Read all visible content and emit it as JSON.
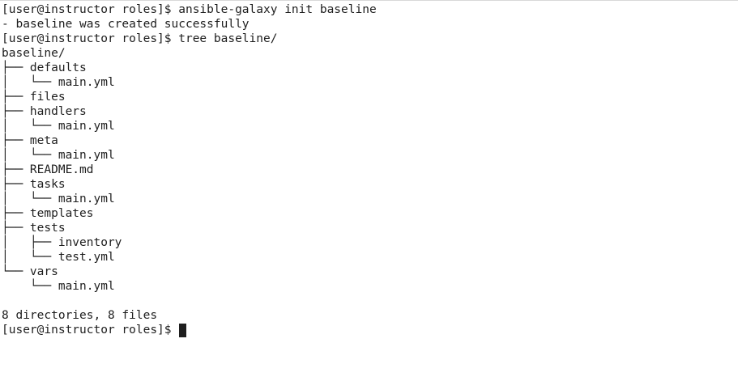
{
  "terminal": {
    "lines": [
      "[user@instructor roles]$ ansible-galaxy init baseline",
      "- baseline was created successfully",
      "[user@instructor roles]$ tree baseline/",
      "baseline/",
      "├── defaults",
      "│   └── main.yml",
      "├── files",
      "├── handlers",
      "│   └── main.yml",
      "├── meta",
      "│   └── main.yml",
      "├── README.md",
      "├── tasks",
      "│   └── main.yml",
      "├── templates",
      "├── tests",
      "│   ├── inventory",
      "│   └── test.yml",
      "└── vars",
      "    └── main.yml",
      "",
      "8 directories, 8 files"
    ],
    "prompt": "[user@instructor roles]$ ",
    "cursor_color": "#1e1e1e"
  }
}
